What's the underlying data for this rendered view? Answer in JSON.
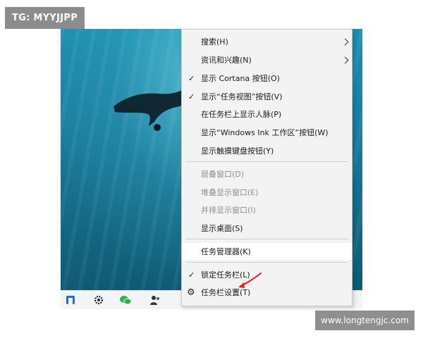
{
  "overlay_tag": "TG: MYYJJPP",
  "watermark": "www.longtengjc.com",
  "menu": {
    "items": [
      {
        "label": "搜索(H)",
        "submenu": true
      },
      {
        "label": "资讯和兴趣(N)",
        "submenu": true
      },
      {
        "label": "显示 Cortana 按钮(O)",
        "checked": true
      },
      {
        "label": "显示“任务视图”按钮(V)",
        "checked": true
      },
      {
        "label": "在任务栏上显示人脉(P)"
      },
      {
        "label": "显示“Windows Ink 工作区”按钮(W)"
      },
      {
        "label": "显示触摸键盘按钮(Y)"
      },
      {
        "label": "层叠窗口(D)",
        "disabled": true
      },
      {
        "label": "堆叠显示窗口(E)",
        "disabled": true
      },
      {
        "label": "并排显示窗口(I)",
        "disabled": true
      },
      {
        "label": "显示桌面(S)"
      },
      {
        "label": "任务管理器(K)",
        "highlighted": true
      },
      {
        "label": "锁定任务栏(L)",
        "checked": true
      },
      {
        "label": "任务栏设置(T)",
        "icon": "gear-icon"
      }
    ]
  },
  "taskbar": {
    "tray_text_1": "…",
    "icons": [
      "app-icon",
      "settings-gear-icon",
      "wechat-icon",
      "people-icon"
    ]
  },
  "colors": {
    "annotation_arrow": "#e02020",
    "menu_bg": "#f3f3f3",
    "water": "#1a7d9e"
  }
}
